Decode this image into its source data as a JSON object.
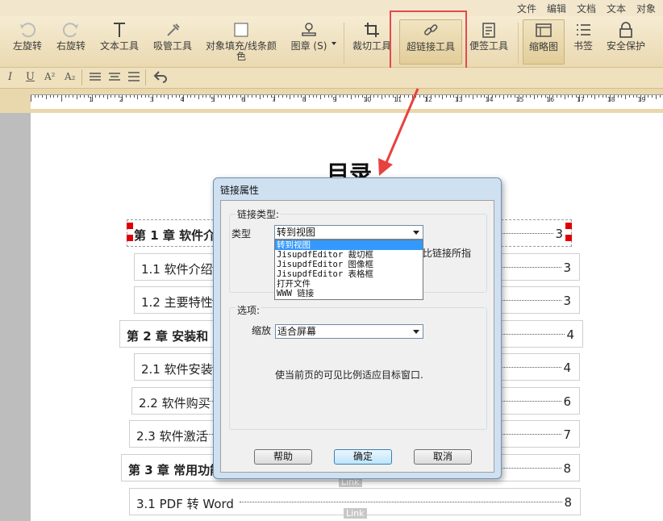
{
  "menu": {
    "file": "文件",
    "edit": "编辑",
    "document": "文档",
    "text": "文本",
    "object": "对象"
  },
  "toolbar": {
    "rotate_left": "左旋转",
    "rotate_right": "右旋转",
    "text_tool": "文本工具",
    "eyedropper": "吸管工具",
    "fill_color_1": "对象填充/线条颜",
    "fill_color_2": "色",
    "stamp": "图章 (S)",
    "crop": "裁切工具",
    "hyperlink": "超链接工具",
    "note": "便签工具",
    "thumbnail": "缩略图",
    "bookmark": "书签",
    "security": "安全保护"
  },
  "format": {
    "italic": "I",
    "underline": "U",
    "superscript": "A²",
    "subscript": "A₂"
  },
  "ruler": {
    "numbers": [
      "1",
      "2",
      "3",
      "4",
      "5",
      "6",
      "7",
      "8",
      "9",
      "10",
      "11",
      "12",
      "13",
      "14",
      "15",
      "16",
      "17",
      "18",
      "19",
      "20"
    ]
  },
  "document": {
    "title": "目录",
    "toc": [
      {
        "text": "第 1 章  软件介绍",
        "page": "3"
      },
      {
        "text": "1.1 软件介绍",
        "page": "3"
      },
      {
        "text": "1.2 主要特性",
        "page": "3"
      },
      {
        "text": "第 2 章   安装和",
        "page": "4"
      },
      {
        "text": "2.1 软件安装",
        "page": "4"
      },
      {
        "text": "2.2 软件购买",
        "page": "6"
      },
      {
        "text": "2.3 软件激活",
        "page": "7"
      },
      {
        "text": "第 3 章  常用功能",
        "page": "8"
      },
      {
        "text": "3.1  PDF 转 Word",
        "page": "8"
      }
    ],
    "link_tags": [
      "Link",
      "Link"
    ]
  },
  "dialog": {
    "title": "链接属性",
    "link_type_group": "链接类型:",
    "type_label": "类型",
    "type_value": "转到视图",
    "type_options": [
      "转到视图",
      "JisupdfEditor 裁切框",
      "JisupdfEditor 图像框",
      "JisupdfEditor 表格框",
      "打开文件",
      "WWW 链接"
    ],
    "hint_text": "比链接所指",
    "options_group": "选项:",
    "zoom_label": "缩放",
    "zoom_value": "适合屏幕",
    "zoom_desc": "使当前页的可见比例适应目标窗口.",
    "help_button": "帮助",
    "ok_button": "确定",
    "cancel_button": "取消"
  },
  "colors": {
    "highlight": "#e24b4b",
    "selection": "#3399ff",
    "toolbar": "#f2e7cc"
  }
}
